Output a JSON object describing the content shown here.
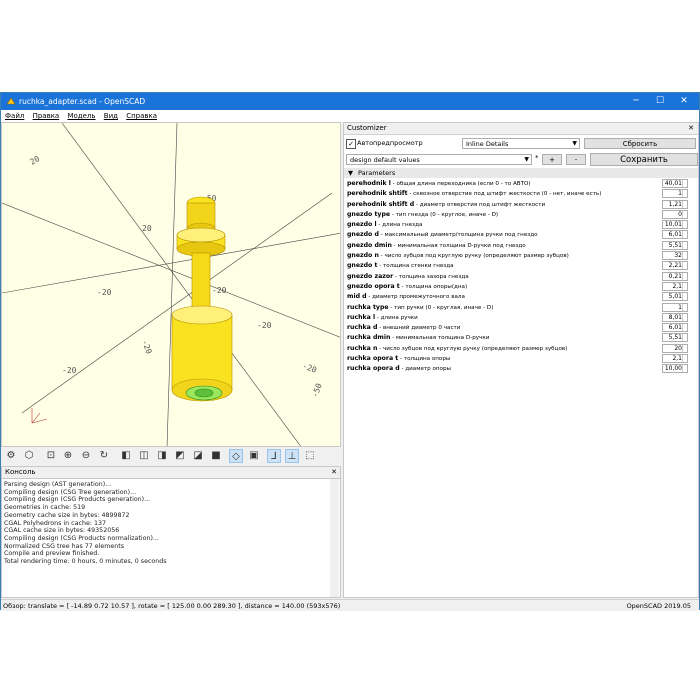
{
  "window": {
    "title": "ruchka_adapter.scad - OpenSCAD"
  },
  "menu": [
    "Файл",
    "Правка",
    "Модель",
    "Вид",
    "Справка"
  ],
  "viewport": {
    "axis_labels": [
      "20",
      "20",
      "-20",
      "-20",
      "-20",
      "-20",
      "-20",
      "-20",
      "-50",
      "-50"
    ]
  },
  "toolbar": {
    "buttons": [
      "render-icon",
      "preview-3d-icon",
      "view-all-icon",
      "zoom-in-icon",
      "zoom-out-icon",
      "reset-view-icon",
      "view-right-icon",
      "view-top-icon",
      "view-bottom-icon",
      "view-left-icon",
      "view-front-icon",
      "view-back-icon",
      "perspective-icon",
      "orthogonal-icon",
      "show-axes-icon",
      "show-scale-icon",
      "show-edges-icon"
    ]
  },
  "console": {
    "title": "Консоль",
    "lines": [
      "Parsing design (AST generation)...",
      "Compiling design (CSG Tree generation)...",
      "Compiling design (CSG Products generation)...",
      "Geometries in cache: 519",
      "Geometry cache size in bytes: 4899872",
      "CGAL Polyhedrons in cache: 137",
      "CGAL cache size in bytes: 49352056",
      "Compiling design (CSG Products normalization)...",
      "Normalized CSG tree has 77 elements",
      "Compile and preview finished.",
      "Total rendering time: 0 hours, 0 minutes, 0 seconds"
    ]
  },
  "status": {
    "left": "Обзор: translate = [ -14.89 0.72 10.57 ], rotate = [ 125.00 0.00 289.30 ], distance = 140.00 (593x576)",
    "right": "OpenSCAD 2019.05"
  },
  "customizer": {
    "title": "Customizer",
    "autopreview_label": "Автопредпросмотр",
    "details_value": "Inline Details",
    "reset_label": "Сбросить",
    "preset_value": "design default values",
    "preset_star": "*",
    "plus": "+",
    "minus": "-",
    "save_preset_label": "Сохранить предустановку",
    "group_label": "Parameters",
    "params": [
      {
        "name": "perehodnik l",
        "desc": " - общая длина переходника (если 0 - то АВТО)",
        "value": "40,01"
      },
      {
        "name": "perehodnik shtift",
        "desc": " - сквозное отверстие под штифт жесткости (0 - нет, иначе есть)",
        "value": "1"
      },
      {
        "name": "perehodnik shtift d",
        "desc": " - диаметр отверстия под штифт жесткости",
        "value": "1,21"
      },
      {
        "name": "gnezdo type",
        "desc": " - тип гнезда (0 - круглое, иначе - D)",
        "value": "0"
      },
      {
        "name": "gnezdo l",
        "desc": " - длина гнезда",
        "value": "10,01"
      },
      {
        "name": "gnezdo d",
        "desc": " - максимальный диаметр/толщина ручки под гнездо",
        "value": "6,01"
      },
      {
        "name": "gnezdo dmin",
        "desc": " - минимальная толщина D-ручки под гнездо",
        "value": "5,51"
      },
      {
        "name": "gnezdo n",
        "desc": " - число зубцов под круглую ручку (определяют размер зубцов)",
        "value": "32"
      },
      {
        "name": "gnezdo t",
        "desc": " - толщина стенки гнезда",
        "value": "2,21"
      },
      {
        "name": "gnezdo zazor",
        "desc": " - толщина зазора гнезда",
        "value": "0,21"
      },
      {
        "name": "gnezdo opora t",
        "desc": " - толщина опоры(дна)",
        "value": "2,1"
      },
      {
        "name": "mid d",
        "desc": " - диаметр промежуточного вала",
        "value": "5,01"
      },
      {
        "name": "ruchka type",
        "desc": " - тип ручки (0 - круглая, иначе - D)",
        "value": "1"
      },
      {
        "name": "ruchka l",
        "desc": " - длина ручки",
        "value": "8,01"
      },
      {
        "name": "ruchka d",
        "desc": " - внешний диаметр 0 части",
        "value": "6,01"
      },
      {
        "name": "ruchka dmin",
        "desc": " - минимальная толщина D-ручки",
        "value": "5,51"
      },
      {
        "name": "ruchka n",
        "desc": " - число зубцов под круглую ручку (определяют размер зубцов)",
        "value": "20"
      },
      {
        "name": "ruchka opora t",
        "desc": " - толщина опоры",
        "value": "2,1"
      },
      {
        "name": "ruchka opora d",
        "desc": " - диаметр опоры",
        "value": "10,00"
      }
    ]
  },
  "colors": {
    "titlebar": "#1a73d9",
    "model": "#f9e21f",
    "viewport_bg": "#ffffe5",
    "hole": "#9be65a"
  }
}
